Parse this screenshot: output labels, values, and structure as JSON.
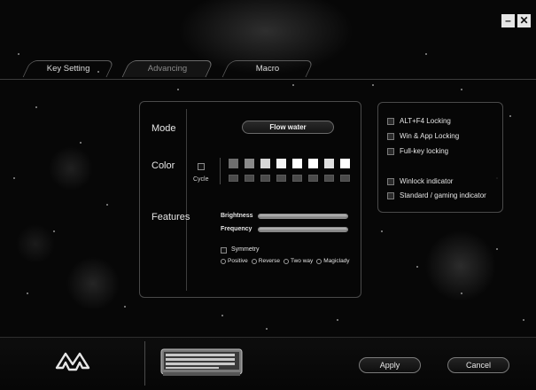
{
  "window_controls": {
    "minimize": "–",
    "close": "✕"
  },
  "tabs": [
    {
      "label": "Key Setting",
      "active": false
    },
    {
      "label": "Advancing",
      "active": true
    },
    {
      "label": "Macro",
      "active": false
    }
  ],
  "settings": {
    "mode_label": "Mode",
    "mode_value": "Flow water",
    "color_label": "Color",
    "cycle_label": "Cycle",
    "swatches": [
      "#6e6e6e",
      "#8a8a8a",
      "#d6d6d6",
      "#f4f4f4",
      "#ffffff",
      "#ffffff",
      "#e0e0e0",
      "#ffffff"
    ],
    "features_label": "Features",
    "brightness_label": "Brightness",
    "brightness_level": 1.0,
    "frequency_label": "Frequency",
    "frequency_level": 1.0,
    "symmetry_label": "Symmetry",
    "radio_options": [
      "Positive",
      "Reverse",
      "Two way",
      "Magiclady"
    ]
  },
  "locking": {
    "items": [
      {
        "label": "ALT+F4 Locking"
      },
      {
        "label": "Win & App Locking"
      },
      {
        "label": "Full-key locking"
      },
      {
        "label": "Winlock indicator"
      },
      {
        "label": "Standard / gaming indicator"
      }
    ]
  },
  "footer": {
    "apply_label": "Apply",
    "cancel_label": "Cancel"
  },
  "colors": {
    "background": "#070707",
    "panel_border": "#4a4a4a",
    "text": "#e8e8e8"
  },
  "icons": [
    "minimize-icon",
    "close-icon",
    "logo-icon",
    "keyboard-image"
  ]
}
